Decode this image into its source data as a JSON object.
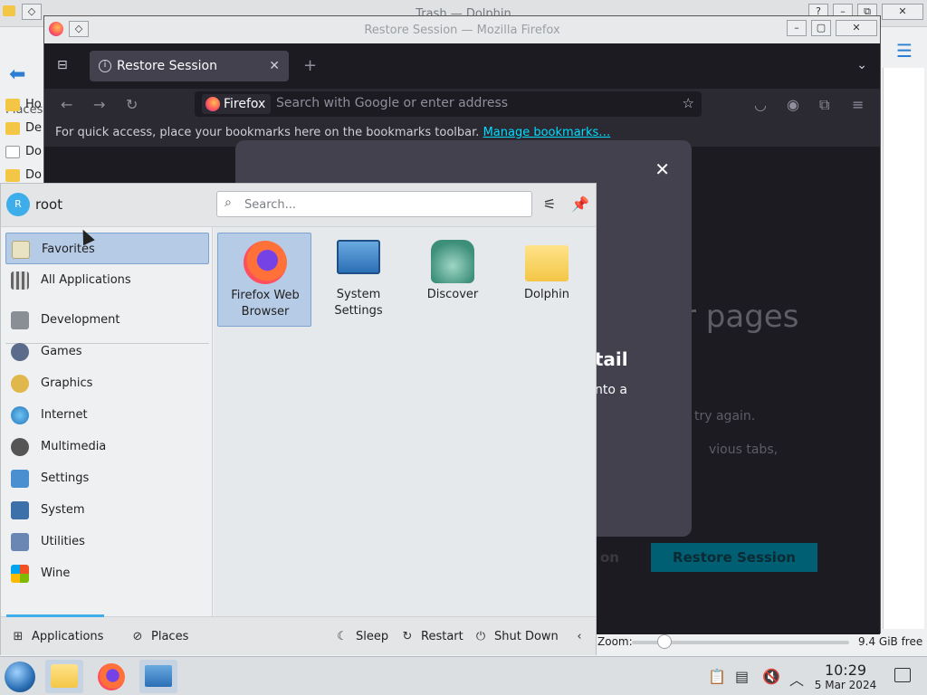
{
  "dolphin": {
    "title": "Trash — Dolphin",
    "places_label": "Places",
    "places": [
      "Ho",
      "De",
      "Do",
      "Do"
    ],
    "zoom_label": "Zoom:",
    "free_space": "9.4 GiB free"
  },
  "firefox": {
    "window_title": "Restore Session — Mozilla Firefox",
    "tab_label": "Restore Session",
    "url_brand": "Firefox",
    "url_placeholder": "Search with Google or enter address",
    "bookmarks_text": "For quick access, place your bookmarks here on the bookmarks toolbar.",
    "bookmarks_link": "Manage bookmarks…",
    "page_heading_partial": "r pages",
    "page_line1_partial": "try again.",
    "page_line2_partial": "vious tabs,",
    "button_partial": "on",
    "restore_button": "Restore Session",
    "dialog": {
      "title_partial": "r tail",
      "body_partial": "e into a"
    }
  },
  "launcher": {
    "user_initial": "R",
    "user_name": "root",
    "search_placeholder": "Search...",
    "categories": [
      {
        "label": "Favorites",
        "icon": "favorites-icon"
      },
      {
        "label": "All Applications",
        "icon": "all-apps-icon"
      },
      {
        "label": "Development",
        "icon": "development-icon"
      },
      {
        "label": "Games",
        "icon": "games-icon"
      },
      {
        "label": "Graphics",
        "icon": "graphics-icon"
      },
      {
        "label": "Internet",
        "icon": "internet-icon"
      },
      {
        "label": "Multimedia",
        "icon": "multimedia-icon"
      },
      {
        "label": "Settings",
        "icon": "settings-icon"
      },
      {
        "label": "System",
        "icon": "system-icon"
      },
      {
        "label": "Utilities",
        "icon": "utilities-icon"
      },
      {
        "label": "Wine",
        "icon": "wine-icon"
      }
    ],
    "apps": [
      {
        "label": "Firefox Web Browser",
        "icon": "firefox-icon"
      },
      {
        "label": "System Settings",
        "icon": "system-settings-icon"
      },
      {
        "label": "Discover",
        "icon": "discover-icon"
      },
      {
        "label": "Dolphin",
        "icon": "dolphin-folder-icon"
      }
    ],
    "footer": {
      "applications": "Applications",
      "places": "Places",
      "sleep": "Sleep",
      "restart": "Restart",
      "shutdown": "Shut Down"
    }
  },
  "taskbar": {
    "time": "10:29",
    "date": "5 Mar 2024"
  },
  "colors": {
    "accent": "#3daee9",
    "selection": "#b6cbe6",
    "firefox_bg": "#1c1b22",
    "dialog_bg": "#42414d",
    "restore_button": "#005f73"
  }
}
